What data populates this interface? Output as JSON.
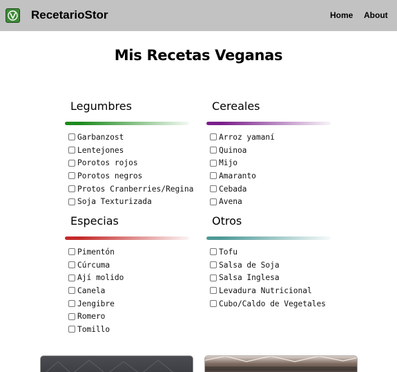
{
  "nav": {
    "brand": "RecetarioStor",
    "logo_icon": "leaf-v-icon",
    "links": [
      {
        "label": "Home"
      },
      {
        "label": "About"
      }
    ]
  },
  "page": {
    "title": "Mis Recetas Veganas"
  },
  "categories": [
    {
      "title": "Legumbres",
      "color": "#1e8a1e",
      "items": [
        "Garbanzost",
        "Lentejones",
        "Porotos rojos",
        "Porotos negros",
        "Protos Cranberries/Regina",
        "Soja Texturizada"
      ]
    },
    {
      "title": "Cereales",
      "color": "#7a1f8a",
      "items": [
        "Arroz yamaní",
        "Quinoa",
        "Mijo",
        "Amaranto",
        "Cebada",
        "Avena"
      ]
    },
    {
      "title": "Especias",
      "color": "#c42a2a",
      "items": [
        "Pimentón",
        "Cúrcuma",
        "Ají molido",
        "Canela",
        "Jengibre",
        "Romero",
        "Tomillo"
      ]
    },
    {
      "title": "Otros",
      "color": "#4e9a98",
      "items": [
        "Tofu",
        "Salsa de Soja",
        "Salsa Inglesa",
        "Levadura Nutricional",
        "Cubo/Caldo de Vegetales"
      ]
    }
  ]
}
